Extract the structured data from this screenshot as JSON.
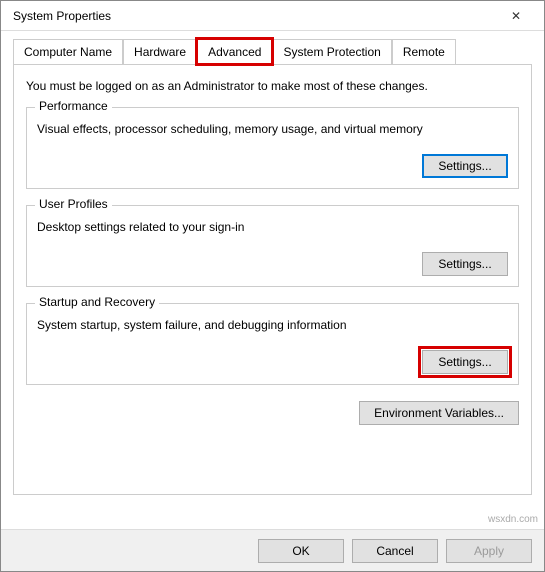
{
  "window": {
    "title": "System Properties",
    "close_glyph": "✕"
  },
  "tabs": {
    "items": [
      {
        "label": "Computer Name"
      },
      {
        "label": "Hardware"
      },
      {
        "label": "Advanced"
      },
      {
        "label": "System Protection"
      },
      {
        "label": "Remote"
      }
    ],
    "selected_index": 2
  },
  "intro": "You must be logged on as an Administrator to make most of these changes.",
  "groups": {
    "performance": {
      "legend": "Performance",
      "desc": "Visual effects, processor scheduling, memory usage, and virtual memory",
      "button": "Settings..."
    },
    "user_profiles": {
      "legend": "User Profiles",
      "desc": "Desktop settings related to your sign-in",
      "button": "Settings..."
    },
    "startup_recovery": {
      "legend": "Startup and Recovery",
      "desc": "System startup, system failure, and debugging information",
      "button": "Settings..."
    }
  },
  "env_button": "Environment Variables...",
  "footer": {
    "ok": "OK",
    "cancel": "Cancel",
    "apply": "Apply"
  },
  "watermark": "wsxdn.com"
}
